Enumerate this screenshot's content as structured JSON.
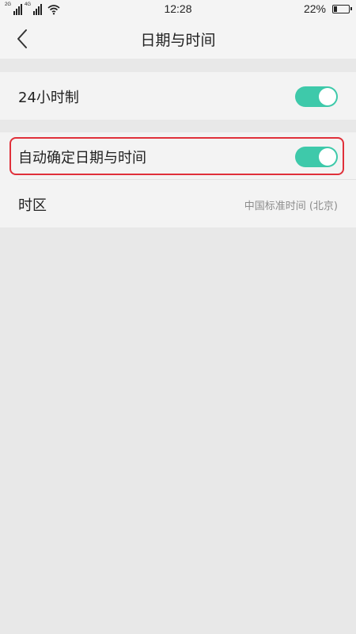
{
  "status_bar": {
    "network_1": "2G",
    "network_2": "4G",
    "time": "12:28",
    "battery_percent": "22%",
    "battery_level": 0.22
  },
  "header": {
    "title": "日期与时间",
    "back_icon": "chevron-left-icon"
  },
  "settings": {
    "hour24": {
      "label": "24小时制",
      "enabled": true
    },
    "auto_datetime": {
      "label": "自动确定日期与时间",
      "enabled": true
    },
    "timezone": {
      "label": "时区",
      "value": "中国标准时间 (北京)"
    }
  },
  "colors": {
    "toggle_on": "#3ec9aa",
    "highlight": "#e0303a",
    "background": "#e8e8e8",
    "row_background": "#f3f3f3"
  }
}
